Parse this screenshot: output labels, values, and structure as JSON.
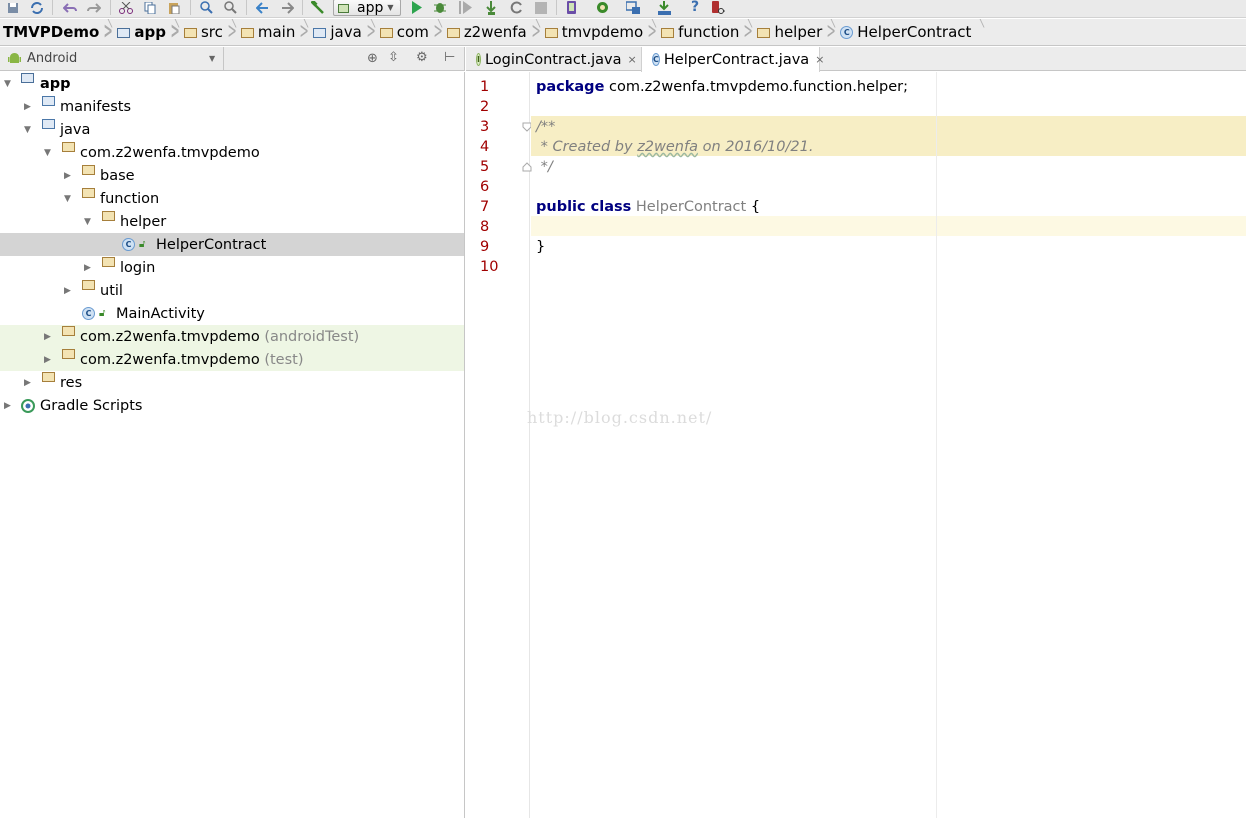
{
  "toolbar": {
    "run_config": "app"
  },
  "breadcrumb": [
    {
      "label": "TMVPDemo",
      "bold": true,
      "icon": "none"
    },
    {
      "label": "app",
      "bold": true,
      "icon": "module"
    },
    {
      "label": "src",
      "icon": "folder"
    },
    {
      "label": "main",
      "icon": "folder"
    },
    {
      "label": "java",
      "icon": "folder-blue"
    },
    {
      "label": "com",
      "icon": "folder"
    },
    {
      "label": "z2wenfa",
      "icon": "folder"
    },
    {
      "label": "tmvpdemo",
      "icon": "folder"
    },
    {
      "label": "function",
      "icon": "folder"
    },
    {
      "label": "helper",
      "icon": "folder"
    },
    {
      "label": "HelperContract",
      "icon": "class"
    }
  ],
  "project_view": {
    "selector": "Android"
  },
  "tree": [
    {
      "label": "app",
      "bold": true,
      "level": 0,
      "arrow": "down",
      "icon": "module"
    },
    {
      "label": "manifests",
      "level": 1,
      "arrow": "right",
      "icon": "folder-blue"
    },
    {
      "label": "java",
      "level": 1,
      "arrow": "down",
      "icon": "folder-blue"
    },
    {
      "label": "com.z2wenfa.tmvpdemo",
      "level": 2,
      "arrow": "down",
      "icon": "package"
    },
    {
      "label": "base",
      "level": 3,
      "arrow": "right",
      "icon": "package"
    },
    {
      "label": "function",
      "level": 3,
      "arrow": "down",
      "icon": "package"
    },
    {
      "label": "helper",
      "level": 4,
      "arrow": "down",
      "icon": "package"
    },
    {
      "label": "HelperContract",
      "level": 5,
      "arrow": "none",
      "icon": "class",
      "selected": true
    },
    {
      "label": "login",
      "level": 4,
      "arrow": "right",
      "icon": "package"
    },
    {
      "label": "util",
      "level": 3,
      "arrow": "right",
      "icon": "package"
    },
    {
      "label": "MainActivity",
      "level": 4,
      "arrow": "none",
      "icon": "class"
    },
    {
      "label": "com.z2wenfa.tmvpdemo",
      "suffix": "(androidTest)",
      "level": 2,
      "arrow": "right",
      "icon": "package",
      "highlight": true
    },
    {
      "label": "com.z2wenfa.tmvpdemo",
      "suffix": "(test)",
      "level": 2,
      "arrow": "right",
      "icon": "package",
      "highlight": true
    },
    {
      "label": "res",
      "level": 1,
      "arrow": "right",
      "icon": "folder-res"
    },
    {
      "label": "Gradle Scripts",
      "level": 0,
      "arrow": "right",
      "icon": "gradle"
    }
  ],
  "tabs": [
    {
      "label": "LoginContract.java",
      "icon": "interface",
      "close": "×"
    },
    {
      "label": "HelperContract.java",
      "icon": "class",
      "active": true,
      "close": "×"
    }
  ],
  "editor": {
    "line_numbers": [
      "1",
      "2",
      "3",
      "4",
      "5",
      "6",
      "7",
      "8",
      "9",
      "10"
    ],
    "lines": {
      "l1_kw": "package",
      "l1_rest": " com.z2wenfa.tmvpdemo.function.helper;",
      "l3": "/**",
      "l4_a": " * Created by ",
      "l4_b": "z2wenfa",
      "l4_c": " on 2016/10/21.",
      "l5": " */",
      "l7_kw": "public class",
      "l7_name": " HelperContract",
      "l7_brace": " {",
      "l9": "}"
    },
    "watermark": "http://blog.csdn.net/"
  },
  "colors": {
    "selection": "#d4d4d4",
    "test_highlight": "#eef6e4",
    "doc_comment_bg": "#f7eec5",
    "caret_line": "#fdf9e3",
    "keyword": "#000080",
    "line_number": "#a00000"
  }
}
